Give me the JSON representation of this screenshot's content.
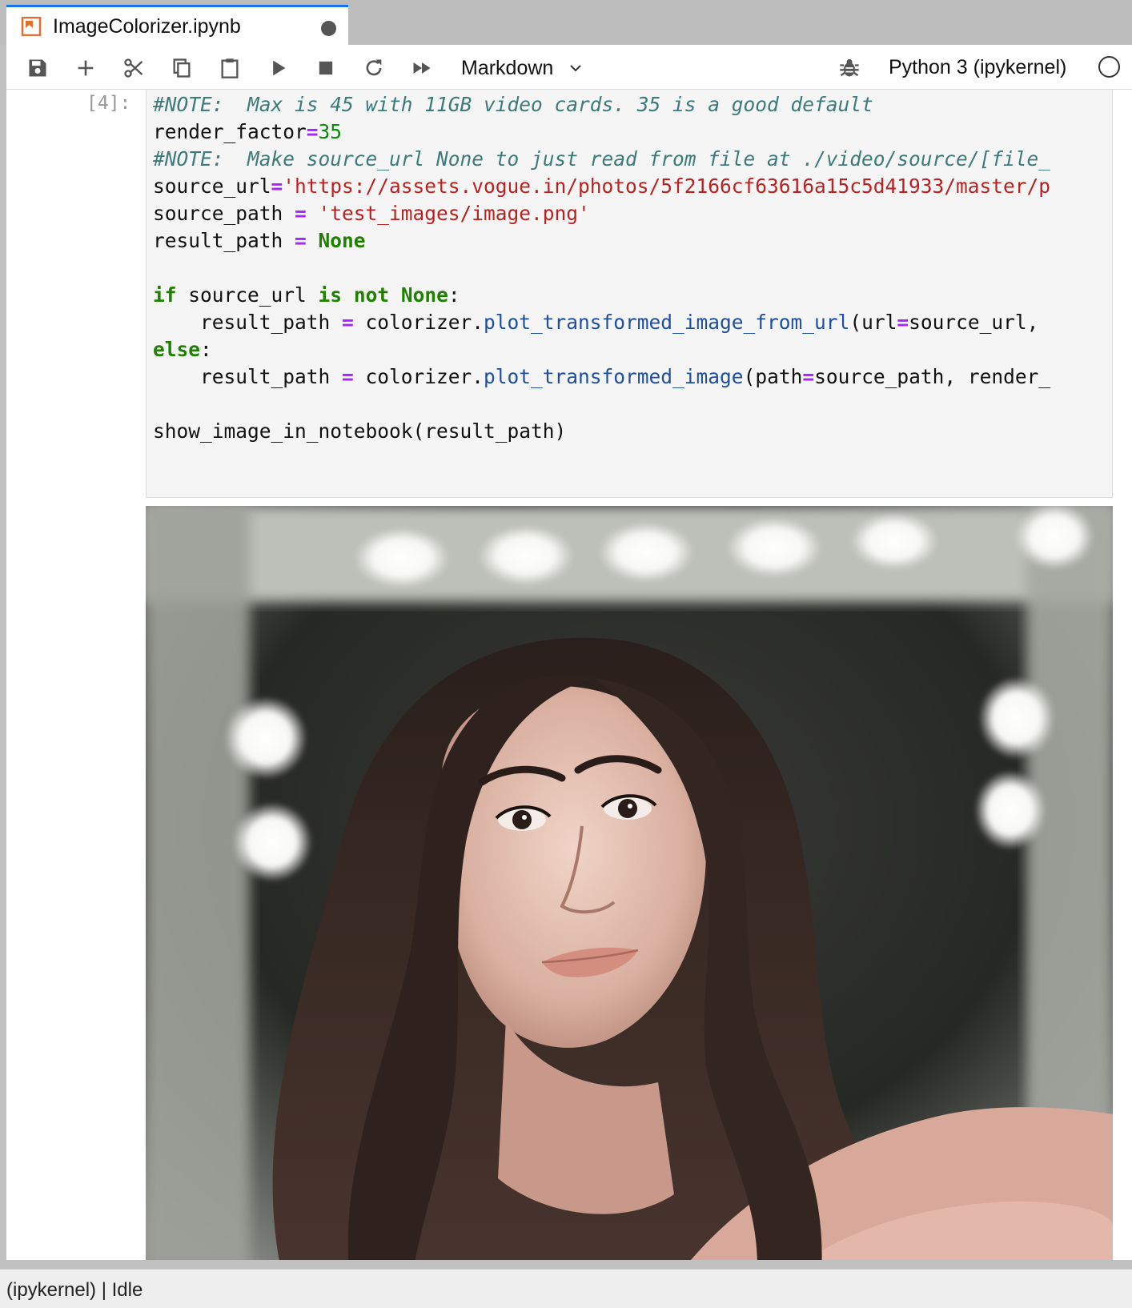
{
  "tab": {
    "title": "ImageColorizer.ipynb",
    "icon": "notebook-icon",
    "dirty": true
  },
  "toolbar": {
    "buttons": [
      {
        "name": "save-button",
        "icon": "save-icon"
      },
      {
        "name": "insert-cell-button",
        "icon": "plus-icon"
      },
      {
        "name": "cut-button",
        "icon": "scissors-icon"
      },
      {
        "name": "copy-button",
        "icon": "copy-icon"
      },
      {
        "name": "paste-button",
        "icon": "clipboard-icon"
      },
      {
        "name": "run-button",
        "icon": "play-icon"
      },
      {
        "name": "interrupt-button",
        "icon": "stop-icon"
      },
      {
        "name": "restart-button",
        "icon": "restart-icon"
      },
      {
        "name": "restart-run-all-button",
        "icon": "fast-forward-icon"
      }
    ],
    "cell_type": "Markdown",
    "kernel_name": "Python 3 (ipykernel)"
  },
  "cell": {
    "prompt": "[4]:",
    "code_lines": [
      [
        {
          "t": "#NOTE:  Max is 45 with 11GB video cards. 35 is a good default",
          "c": "cm"
        }
      ],
      [
        {
          "t": "render_factor"
        },
        {
          "t": "=",
          "c": "op"
        },
        {
          "t": "35",
          "c": "num"
        }
      ],
      [
        {
          "t": "#NOTE:  Make source_url None to just read from file at ./video/source/[file_",
          "c": "cm"
        }
      ],
      [
        {
          "t": "source_url"
        },
        {
          "t": "=",
          "c": "op"
        },
        {
          "t": "'https://assets.vogue.in/photos/5f2166cf63616a15c5d41933/master/p",
          "c": "str"
        }
      ],
      [
        {
          "t": "source_path "
        },
        {
          "t": "=",
          "c": "op"
        },
        {
          "t": " "
        },
        {
          "t": "'test_images/image.png'",
          "c": "str"
        }
      ],
      [
        {
          "t": "result_path "
        },
        {
          "t": "=",
          "c": "op"
        },
        {
          "t": " "
        },
        {
          "t": "None",
          "c": "kw"
        }
      ],
      [
        {
          "t": ""
        }
      ],
      [
        {
          "t": "if",
          "c": "kw"
        },
        {
          "t": " source_url "
        },
        {
          "t": "is",
          "c": "kw"
        },
        {
          "t": " "
        },
        {
          "t": "not",
          "c": "kw"
        },
        {
          "t": " "
        },
        {
          "t": "None",
          "c": "kw"
        },
        {
          "t": ":"
        }
      ],
      [
        {
          "t": "    result_path "
        },
        {
          "t": "=",
          "c": "op"
        },
        {
          "t": " colorizer."
        },
        {
          "t": "plot_transformed_image_from_url",
          "c": "fn"
        },
        {
          "t": "(url"
        },
        {
          "t": "=",
          "c": "op"
        },
        {
          "t": "source_url,"
        }
      ],
      [
        {
          "t": "else",
          "c": "kw"
        },
        {
          "t": ":"
        }
      ],
      [
        {
          "t": "    result_path "
        },
        {
          "t": "=",
          "c": "op"
        },
        {
          "t": " colorizer."
        },
        {
          "t": "plot_transformed_image",
          "c": "fn"
        },
        {
          "t": "(path"
        },
        {
          "t": "=",
          "c": "op"
        },
        {
          "t": "source_path, render_"
        }
      ],
      [
        {
          "t": ""
        }
      ],
      [
        {
          "t": "show_image_in_notebook(result_path)"
        }
      ]
    ]
  },
  "status": {
    "text": "(ipykernel) | Idle"
  },
  "colors": {
    "tab_accent": "#1a73e8",
    "comment": "#3d7a7a",
    "string": "#ba2121",
    "keyword": "#208000",
    "operator": "#aa22ff",
    "function": "#1f4fa0",
    "number": "#0a8a0a"
  }
}
